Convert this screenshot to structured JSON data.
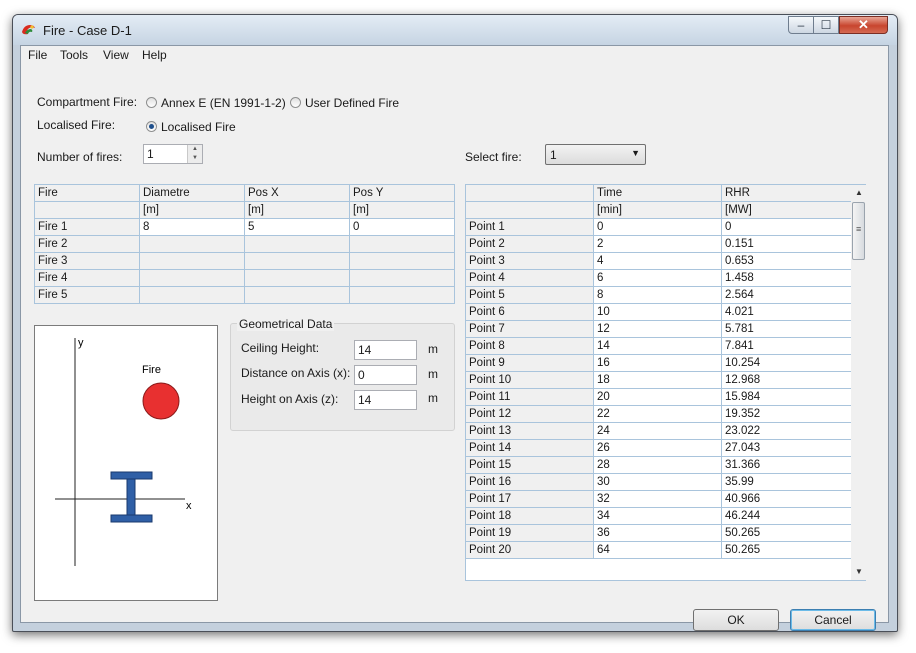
{
  "window": {
    "title": "Fire - Case D-1"
  },
  "menu": [
    "File",
    "Tools",
    "View",
    "Help"
  ],
  "compartment_fire": {
    "label": "Compartment Fire:",
    "option1": "Annex E (EN 1991-1-2)",
    "option2": "User Defined Fire"
  },
  "localised_fire": {
    "label": "Localised Fire:",
    "option": "Localised Fire"
  },
  "num_fires": {
    "label": "Number of fires:",
    "value": "1"
  },
  "select_fire": {
    "label": "Select fire:",
    "value": "1"
  },
  "fires_table": {
    "headers": [
      "Fire",
      "Diametre",
      "Pos X",
      "Pos Y"
    ],
    "units": [
      "",
      "[m]",
      "[m]",
      "[m]"
    ],
    "rows": [
      [
        "Fire 1",
        "8",
        "5",
        "0"
      ],
      [
        "Fire 2",
        "",
        "",
        ""
      ],
      [
        "Fire 3",
        "",
        "",
        ""
      ],
      [
        "Fire 4",
        "",
        "",
        ""
      ],
      [
        "Fire 5",
        "",
        "",
        ""
      ]
    ]
  },
  "diagram": {
    "y_label": "y",
    "x_label": "x",
    "fire_label": "Fire",
    "fire_color": "#e83030",
    "beam_color": "#2f5fa6"
  },
  "geometrical": {
    "title": "Geometrical Data",
    "ceiling_label": "Ceiling Height:",
    "ceiling_value": "14",
    "ceiling_unit": "m",
    "distance_label": "Distance on Axis (x):",
    "distance_value": "0",
    "distance_unit": "m",
    "height_label": "Height on Axis (z):",
    "height_value": "14",
    "height_unit": "m"
  },
  "points_table": {
    "headers": [
      "",
      "Time",
      "RHR"
    ],
    "units": [
      "",
      "[min]",
      "[MW]"
    ],
    "rows": [
      [
        "Point 1",
        "0",
        "0"
      ],
      [
        "Point 2",
        "2",
        "0.151"
      ],
      [
        "Point 3",
        "4",
        "0.653"
      ],
      [
        "Point 4",
        "6",
        "1.458"
      ],
      [
        "Point 5",
        "8",
        "2.564"
      ],
      [
        "Point 6",
        "10",
        "4.021"
      ],
      [
        "Point 7",
        "12",
        "5.781"
      ],
      [
        "Point 8",
        "14",
        "7.841"
      ],
      [
        "Point 9",
        "16",
        "10.254"
      ],
      [
        "Point 10",
        "18",
        "12.968"
      ],
      [
        "Point 11",
        "20",
        "15.984"
      ],
      [
        "Point 12",
        "22",
        "19.352"
      ],
      [
        "Point 13",
        "24",
        "23.022"
      ],
      [
        "Point 14",
        "26",
        "27.043"
      ],
      [
        "Point 15",
        "28",
        "31.366"
      ],
      [
        "Point 16",
        "30",
        "35.99"
      ],
      [
        "Point 17",
        "32",
        "40.966"
      ],
      [
        "Point 18",
        "34",
        "46.244"
      ],
      [
        "Point 19",
        "36",
        "50.265"
      ],
      [
        "Point 20",
        "64",
        "50.265"
      ]
    ]
  },
  "buttons": {
    "ok": "OK",
    "cancel": "Cancel"
  }
}
